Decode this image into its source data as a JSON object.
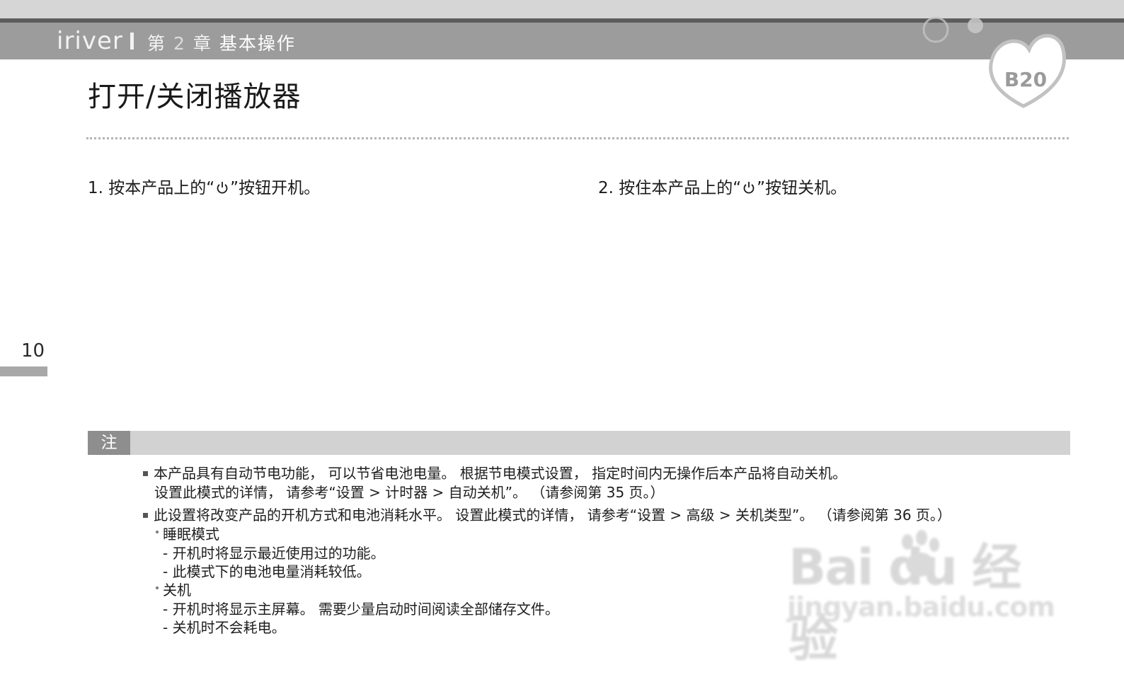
{
  "header": {
    "brand": "iriver",
    "chapter_prefix": "第",
    "chapter_number": "2",
    "chapter_suffix": "章",
    "chapter_name": "基本操作"
  },
  "logo": {
    "model": "B20"
  },
  "page": {
    "title": "打开/关闭播放器",
    "number": "10"
  },
  "steps": [
    {
      "before": "1. 按本产品上的“",
      "after": "”按钮开机。",
      "icon": "power-icon"
    },
    {
      "before": "2. 按住本产品上的“",
      "after": "”按钮关机。",
      "icon": "power-icon"
    }
  ],
  "note": {
    "label": "注",
    "items": [
      {
        "line1": "本产品具有自动节电功能， 可以节省电池电量。 根据节电模式设置， 指定时间内无操作后本产品将自动关机。",
        "line2": "设置此模式的详情， 请参考“设置 > 计时器 > 自动关机”。 （请参阅第 35 页。）"
      },
      {
        "line1": "此设置将改变产品的开机方式和电池消耗水平。 设置此模式的详情， 请参考“设置 > 高级 > 关机类型”。 （请参阅第 36 页。）",
        "modes": [
          {
            "name": "睡眠模式",
            "details": [
              "- 开机时将显示最近使用过的功能。",
              "- 此模式下的电池电量消耗较低。"
            ]
          },
          {
            "name": "关机",
            "details": [
              "- 开机时将显示主屏幕。 需要少量启动时间阅读全部储存文件。",
              "- 关机时不会耗电。"
            ]
          }
        ]
      }
    ]
  },
  "watermark": {
    "main": "Bai  du 经验",
    "sub": "jingyan.baidu.com"
  },
  "colors": {
    "header_band": "#9c9c9c",
    "note_bar": "#d2d2d2",
    "note_label_bg": "#8e8e8e",
    "text": "#1e1e1e"
  }
}
